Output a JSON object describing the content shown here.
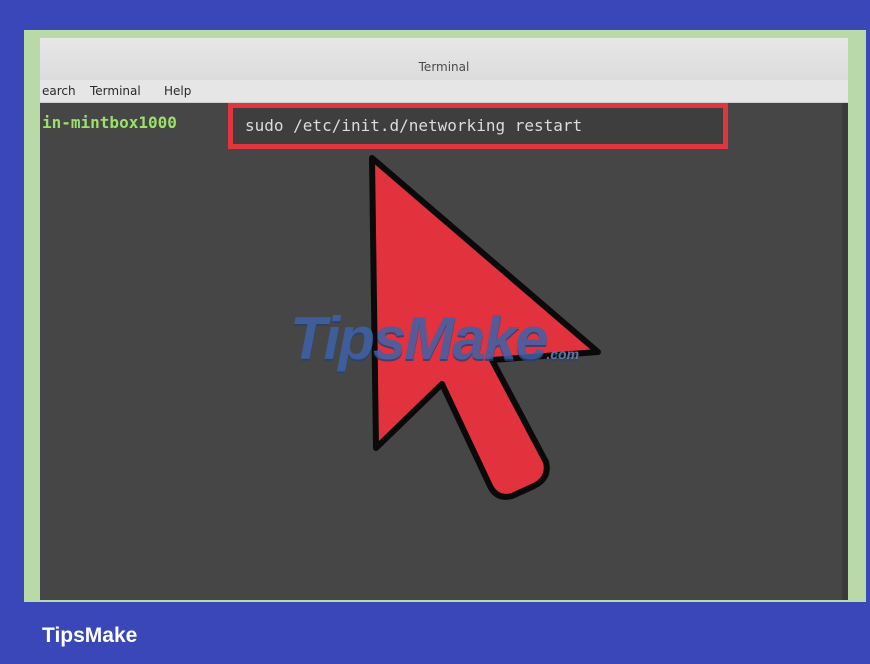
{
  "window": {
    "title": "Terminal"
  },
  "menu": {
    "items": [
      "earch",
      "Terminal",
      "Help"
    ]
  },
  "terminal": {
    "prompt": "in-mintbox1000",
    "command": "sudo /etc/init.d/networking restart"
  },
  "watermark": {
    "text": "TipsMake",
    "suffix": ".com"
  },
  "caption": {
    "brand": "TipsMake"
  },
  "colors": {
    "background": "#3a47b8",
    "frame": "#b9d9a6",
    "terminal_bg": "#464646",
    "prompt": "#9be06b",
    "highlight": "#e0363f",
    "cursor": "#e2323d"
  },
  "icons": {
    "pointer": "mouse-pointer-icon"
  }
}
